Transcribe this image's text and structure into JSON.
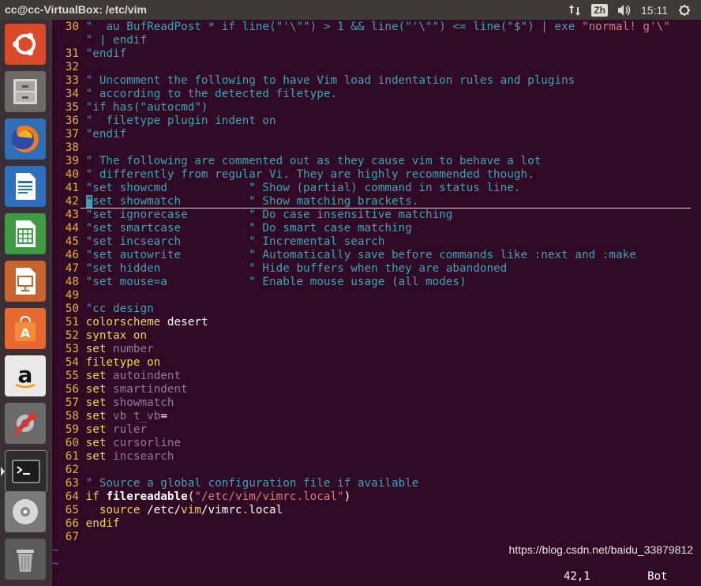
{
  "window": {
    "title": "cc@cc-VirtualBox: /etc/vim"
  },
  "tray": {
    "input_method": "Zh",
    "time": "15:11",
    "icons": [
      "network-updown-icon",
      "keyboard-input-icon",
      "volume-icon",
      "power-gear-icon"
    ]
  },
  "launcher": {
    "items": [
      {
        "name": "ubuntu-dash",
        "label": "Ubuntu Dash"
      },
      {
        "name": "files",
        "label": "Files"
      },
      {
        "name": "firefox",
        "label": "Firefox"
      },
      {
        "name": "libreoffice-writer",
        "label": "LibreOffice Writer"
      },
      {
        "name": "libreoffice-calc",
        "label": "LibreOffice Calc"
      },
      {
        "name": "libreoffice-impress",
        "label": "LibreOffice Impress"
      },
      {
        "name": "software-center",
        "label": "Ubuntu Software"
      },
      {
        "name": "amazon",
        "label": "Amazon"
      },
      {
        "name": "system-settings",
        "label": "System Settings"
      },
      {
        "name": "terminal",
        "label": "Terminal"
      },
      {
        "name": "dvd",
        "label": "DVD"
      },
      {
        "name": "trash",
        "label": "Trash"
      }
    ]
  },
  "vim": {
    "lines": [
      {
        "n": "30",
        "segs": [
          [
            "txt",
            "\"  au BufReadPost * if line(\"'\\\"\") > 1 && line(\"'\\\"\") <= line(\"$\") | exe "
          ],
          [
            "str",
            "\"normal! g'\\\""
          ]
        ]
      },
      {
        "n": "",
        "segs": [
          [
            "txt",
            "\" | endif"
          ]
        ]
      },
      {
        "n": "31",
        "segs": [
          [
            "txt",
            "\"endif"
          ]
        ]
      },
      {
        "n": "32",
        "segs": []
      },
      {
        "n": "33",
        "segs": [
          [
            "txt",
            "\" Uncomment the following to have Vim load indentation rules and plugins"
          ]
        ]
      },
      {
        "n": "34",
        "segs": [
          [
            "txt",
            "\" according to the detected filetype."
          ]
        ]
      },
      {
        "n": "35",
        "segs": [
          [
            "txt",
            "\"if has(\"autocmd\")"
          ]
        ]
      },
      {
        "n": "36",
        "segs": [
          [
            "txt",
            "\"  filetype plugin indent on"
          ]
        ]
      },
      {
        "n": "37",
        "segs": [
          [
            "txt",
            "\"endif"
          ]
        ]
      },
      {
        "n": "38",
        "segs": []
      },
      {
        "n": "39",
        "segs": [
          [
            "txt",
            "\" The following are commented out as they cause vim to behave a lot"
          ]
        ]
      },
      {
        "n": "40",
        "segs": [
          [
            "txt",
            "\" differently from regular Vi. They are highly recommended though."
          ]
        ]
      },
      {
        "n": "41",
        "segs": [
          [
            "txt",
            "\"set showcmd            \" Show (partial) command in status line."
          ]
        ]
      },
      {
        "n": "42",
        "segs": [
          [
            "cursor",
            "\""
          ],
          [
            "txt",
            "set showmatch          \" Show matching brackets."
          ]
        ]
      },
      {
        "n": "43",
        "segs": [
          [
            "txt",
            "\"set ignorecase         \" Do case insensitive matching"
          ]
        ]
      },
      {
        "n": "44",
        "segs": [
          [
            "txt",
            "\"set smartcase          \" Do smart case matching"
          ]
        ]
      },
      {
        "n": "45",
        "segs": [
          [
            "txt",
            "\"set incsearch          \" Incremental search"
          ]
        ]
      },
      {
        "n": "46",
        "segs": [
          [
            "txt",
            "\"set autowrite          \" Automatically save before commands like :next and :make"
          ]
        ]
      },
      {
        "n": "47",
        "segs": [
          [
            "txt",
            "\"set hidden             \" Hide buffers when they are abandoned"
          ]
        ]
      },
      {
        "n": "48",
        "segs": [
          [
            "txt",
            "\"set mouse=a            \" Enable mouse usage (all modes)"
          ]
        ]
      },
      {
        "n": "49",
        "segs": []
      },
      {
        "n": "50",
        "segs": [
          [
            "txt",
            "\"cc design"
          ]
        ]
      },
      {
        "n": "51",
        "segs": [
          [
            "kw",
            "colorscheme "
          ],
          [
            "plain",
            "desert"
          ]
        ]
      },
      {
        "n": "52",
        "segs": [
          [
            "kw",
            "syntax "
          ],
          [
            "on",
            "on"
          ]
        ]
      },
      {
        "n": "53",
        "segs": [
          [
            "kw",
            "set "
          ],
          [
            "val",
            "number"
          ]
        ]
      },
      {
        "n": "54",
        "segs": [
          [
            "kw",
            "filetype "
          ],
          [
            "on",
            "on"
          ]
        ]
      },
      {
        "n": "55",
        "segs": [
          [
            "kw",
            "set "
          ],
          [
            "val",
            "autoindent"
          ]
        ]
      },
      {
        "n": "56",
        "segs": [
          [
            "kw",
            "set "
          ],
          [
            "val",
            "smartindent"
          ]
        ]
      },
      {
        "n": "57",
        "segs": [
          [
            "kw",
            "set "
          ],
          [
            "val",
            "showmatch"
          ]
        ]
      },
      {
        "n": "58",
        "segs": [
          [
            "kw",
            "set "
          ],
          [
            "val",
            "vb t_vb"
          ],
          [
            "plain",
            "="
          ]
        ]
      },
      {
        "n": "59",
        "segs": [
          [
            "kw",
            "set "
          ],
          [
            "val",
            "ruler"
          ]
        ]
      },
      {
        "n": "60",
        "segs": [
          [
            "kw",
            "set "
          ],
          [
            "val",
            "cursorline"
          ]
        ]
      },
      {
        "n": "61",
        "segs": [
          [
            "kw",
            "set "
          ],
          [
            "val",
            "incsearch"
          ]
        ]
      },
      {
        "n": "62",
        "segs": []
      },
      {
        "n": "63",
        "segs": [
          [
            "txt",
            "\" Source a global configuration file if available"
          ]
        ]
      },
      {
        "n": "64",
        "segs": [
          [
            "kw",
            "if "
          ],
          [
            "kw-strong",
            "filereadable"
          ],
          [
            "plain",
            "("
          ],
          [
            "str",
            "\"/etc/vim/vimrc.local\""
          ],
          [
            "plain",
            ")"
          ]
        ]
      },
      {
        "n": "65",
        "segs": [
          [
            "kw",
            "  source "
          ],
          [
            "plain",
            "/etc/"
          ],
          [
            "kw",
            "vim"
          ],
          [
            "plain",
            "/vimrc"
          ],
          [
            "kw",
            "."
          ],
          [
            "plain",
            "local"
          ]
        ]
      },
      {
        "n": "66",
        "segs": [
          [
            "kw",
            "endif"
          ]
        ]
      },
      {
        "n": "67",
        "segs": []
      }
    ],
    "tildes": [
      "~",
      "~"
    ],
    "cursor_line_index": 13
  },
  "status": {
    "position": "42,1",
    "scroll": "Bot"
  },
  "watermark": "https://blog.csdn.net/baidu_33879812"
}
